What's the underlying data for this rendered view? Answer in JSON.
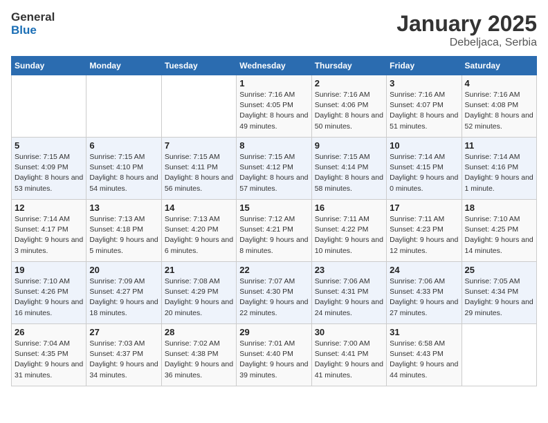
{
  "header": {
    "logo_general": "General",
    "logo_blue": "Blue",
    "month": "January 2025",
    "location": "Debeljaca, Serbia"
  },
  "weekdays": [
    "Sunday",
    "Monday",
    "Tuesday",
    "Wednesday",
    "Thursday",
    "Friday",
    "Saturday"
  ],
  "weeks": [
    [
      {
        "day": "",
        "sunrise": "",
        "sunset": "",
        "daylight": ""
      },
      {
        "day": "",
        "sunrise": "",
        "sunset": "",
        "daylight": ""
      },
      {
        "day": "",
        "sunrise": "",
        "sunset": "",
        "daylight": ""
      },
      {
        "day": "1",
        "sunrise": "Sunrise: 7:16 AM",
        "sunset": "Sunset: 4:05 PM",
        "daylight": "Daylight: 8 hours and 49 minutes."
      },
      {
        "day": "2",
        "sunrise": "Sunrise: 7:16 AM",
        "sunset": "Sunset: 4:06 PM",
        "daylight": "Daylight: 8 hours and 50 minutes."
      },
      {
        "day": "3",
        "sunrise": "Sunrise: 7:16 AM",
        "sunset": "Sunset: 4:07 PM",
        "daylight": "Daylight: 8 hours and 51 minutes."
      },
      {
        "day": "4",
        "sunrise": "Sunrise: 7:16 AM",
        "sunset": "Sunset: 4:08 PM",
        "daylight": "Daylight: 8 hours and 52 minutes."
      }
    ],
    [
      {
        "day": "5",
        "sunrise": "Sunrise: 7:15 AM",
        "sunset": "Sunset: 4:09 PM",
        "daylight": "Daylight: 8 hours and 53 minutes."
      },
      {
        "day": "6",
        "sunrise": "Sunrise: 7:15 AM",
        "sunset": "Sunset: 4:10 PM",
        "daylight": "Daylight: 8 hours and 54 minutes."
      },
      {
        "day": "7",
        "sunrise": "Sunrise: 7:15 AM",
        "sunset": "Sunset: 4:11 PM",
        "daylight": "Daylight: 8 hours and 56 minutes."
      },
      {
        "day": "8",
        "sunrise": "Sunrise: 7:15 AM",
        "sunset": "Sunset: 4:12 PM",
        "daylight": "Daylight: 8 hours and 57 minutes."
      },
      {
        "day": "9",
        "sunrise": "Sunrise: 7:15 AM",
        "sunset": "Sunset: 4:14 PM",
        "daylight": "Daylight: 8 hours and 58 minutes."
      },
      {
        "day": "10",
        "sunrise": "Sunrise: 7:14 AM",
        "sunset": "Sunset: 4:15 PM",
        "daylight": "Daylight: 9 hours and 0 minutes."
      },
      {
        "day": "11",
        "sunrise": "Sunrise: 7:14 AM",
        "sunset": "Sunset: 4:16 PM",
        "daylight": "Daylight: 9 hours and 1 minute."
      }
    ],
    [
      {
        "day": "12",
        "sunrise": "Sunrise: 7:14 AM",
        "sunset": "Sunset: 4:17 PM",
        "daylight": "Daylight: 9 hours and 3 minutes."
      },
      {
        "day": "13",
        "sunrise": "Sunrise: 7:13 AM",
        "sunset": "Sunset: 4:18 PM",
        "daylight": "Daylight: 9 hours and 5 minutes."
      },
      {
        "day": "14",
        "sunrise": "Sunrise: 7:13 AM",
        "sunset": "Sunset: 4:20 PM",
        "daylight": "Daylight: 9 hours and 6 minutes."
      },
      {
        "day": "15",
        "sunrise": "Sunrise: 7:12 AM",
        "sunset": "Sunset: 4:21 PM",
        "daylight": "Daylight: 9 hours and 8 minutes."
      },
      {
        "day": "16",
        "sunrise": "Sunrise: 7:11 AM",
        "sunset": "Sunset: 4:22 PM",
        "daylight": "Daylight: 9 hours and 10 minutes."
      },
      {
        "day": "17",
        "sunrise": "Sunrise: 7:11 AM",
        "sunset": "Sunset: 4:23 PM",
        "daylight": "Daylight: 9 hours and 12 minutes."
      },
      {
        "day": "18",
        "sunrise": "Sunrise: 7:10 AM",
        "sunset": "Sunset: 4:25 PM",
        "daylight": "Daylight: 9 hours and 14 minutes."
      }
    ],
    [
      {
        "day": "19",
        "sunrise": "Sunrise: 7:10 AM",
        "sunset": "Sunset: 4:26 PM",
        "daylight": "Daylight: 9 hours and 16 minutes."
      },
      {
        "day": "20",
        "sunrise": "Sunrise: 7:09 AM",
        "sunset": "Sunset: 4:27 PM",
        "daylight": "Daylight: 9 hours and 18 minutes."
      },
      {
        "day": "21",
        "sunrise": "Sunrise: 7:08 AM",
        "sunset": "Sunset: 4:29 PM",
        "daylight": "Daylight: 9 hours and 20 minutes."
      },
      {
        "day": "22",
        "sunrise": "Sunrise: 7:07 AM",
        "sunset": "Sunset: 4:30 PM",
        "daylight": "Daylight: 9 hours and 22 minutes."
      },
      {
        "day": "23",
        "sunrise": "Sunrise: 7:06 AM",
        "sunset": "Sunset: 4:31 PM",
        "daylight": "Daylight: 9 hours and 24 minutes."
      },
      {
        "day": "24",
        "sunrise": "Sunrise: 7:06 AM",
        "sunset": "Sunset: 4:33 PM",
        "daylight": "Daylight: 9 hours and 27 minutes."
      },
      {
        "day": "25",
        "sunrise": "Sunrise: 7:05 AM",
        "sunset": "Sunset: 4:34 PM",
        "daylight": "Daylight: 9 hours and 29 minutes."
      }
    ],
    [
      {
        "day": "26",
        "sunrise": "Sunrise: 7:04 AM",
        "sunset": "Sunset: 4:35 PM",
        "daylight": "Daylight: 9 hours and 31 minutes."
      },
      {
        "day": "27",
        "sunrise": "Sunrise: 7:03 AM",
        "sunset": "Sunset: 4:37 PM",
        "daylight": "Daylight: 9 hours and 34 minutes."
      },
      {
        "day": "28",
        "sunrise": "Sunrise: 7:02 AM",
        "sunset": "Sunset: 4:38 PM",
        "daylight": "Daylight: 9 hours and 36 minutes."
      },
      {
        "day": "29",
        "sunrise": "Sunrise: 7:01 AM",
        "sunset": "Sunset: 4:40 PM",
        "daylight": "Daylight: 9 hours and 39 minutes."
      },
      {
        "day": "30",
        "sunrise": "Sunrise: 7:00 AM",
        "sunset": "Sunset: 4:41 PM",
        "daylight": "Daylight: 9 hours and 41 minutes."
      },
      {
        "day": "31",
        "sunrise": "Sunrise: 6:58 AM",
        "sunset": "Sunset: 4:43 PM",
        "daylight": "Daylight: 9 hours and 44 minutes."
      },
      {
        "day": "",
        "sunrise": "",
        "sunset": "",
        "daylight": ""
      }
    ]
  ]
}
